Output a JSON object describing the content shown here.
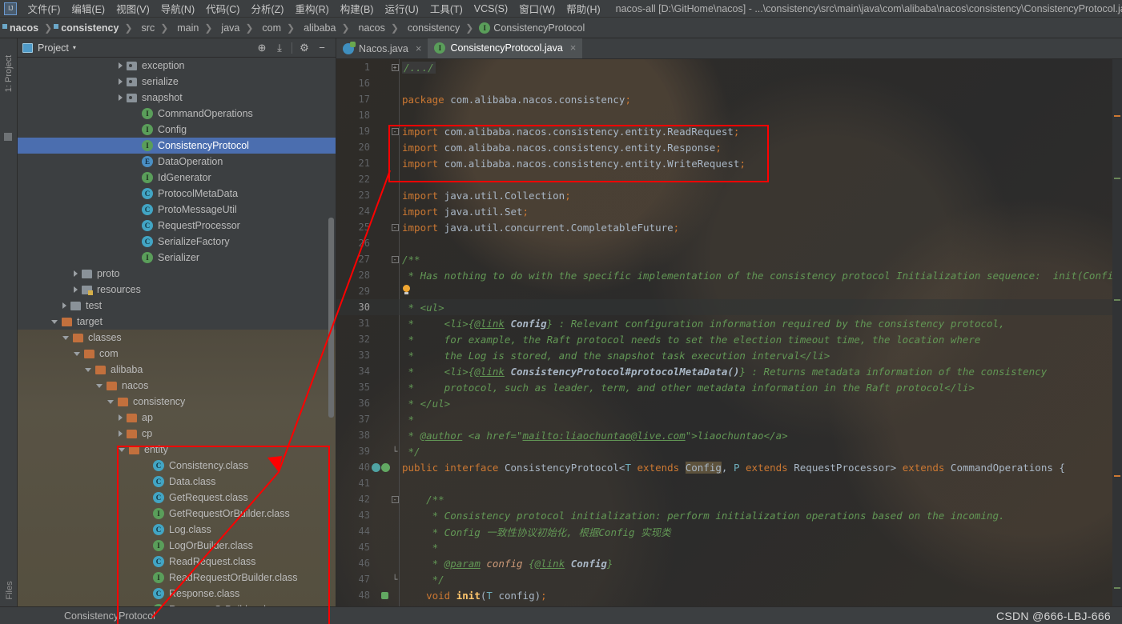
{
  "window": {
    "title": "nacos-all [D:\\GitHome\\nacos] - ...\\consistency\\src\\main\\java\\com\\alibaba\\nacos\\consistency\\ConsistencyProtocol.java [",
    "logo": "app-logo"
  },
  "menu": {
    "items": [
      {
        "label": "文件(F)"
      },
      {
        "label": "编辑(E)"
      },
      {
        "label": "视图(V)"
      },
      {
        "label": "导航(N)"
      },
      {
        "label": "代码(C)"
      },
      {
        "label": "分析(Z)"
      },
      {
        "label": "重构(R)"
      },
      {
        "label": "构建(B)"
      },
      {
        "label": "运行(U)"
      },
      {
        "label": "工具(T)"
      },
      {
        "label": "VCS(S)"
      },
      {
        "label": "窗口(W)"
      },
      {
        "label": "帮助(H)"
      }
    ]
  },
  "breadcrumb": {
    "items": [
      {
        "label": "nacos",
        "icon": "module-icon",
        "bold": true
      },
      {
        "label": "consistency",
        "icon": "module-icon",
        "bold": true
      },
      {
        "label": "src",
        "icon": "folder-icon",
        "bold": false
      },
      {
        "label": "main",
        "icon": "folder-icon",
        "bold": false
      },
      {
        "label": "java",
        "icon": "source-folder-icon",
        "bold": false
      },
      {
        "label": "com",
        "icon": "package-icon",
        "bold": false
      },
      {
        "label": "alibaba",
        "icon": "package-icon",
        "bold": false
      },
      {
        "label": "nacos",
        "icon": "package-icon",
        "bold": false
      },
      {
        "label": "consistency",
        "icon": "package-icon",
        "bold": false
      },
      {
        "label": "ConsistencyProtocol",
        "icon": "interface-icon",
        "bold": false
      }
    ],
    "separator": "❯"
  },
  "left_rail": {
    "top_label": "1: Project",
    "bottom_label": "Files"
  },
  "project_panel": {
    "title": "Project",
    "caret": "▾",
    "buttons": [
      {
        "name": "locate-target-icon",
        "glyph": "⊕"
      },
      {
        "name": "collapse-all-icon",
        "glyph": "⤓"
      },
      {
        "name": "gear-icon",
        "glyph": "⚙"
      },
      {
        "name": "hide-panel-icon",
        "glyph": "−"
      }
    ],
    "tree": [
      {
        "label": "exception",
        "indent": 9,
        "arrow": "right",
        "icon": "package-icon",
        "selected": false,
        "boxed": false
      },
      {
        "label": "serialize",
        "indent": 9,
        "arrow": "right",
        "icon": "package-icon",
        "selected": false,
        "boxed": false
      },
      {
        "label": "snapshot",
        "indent": 9,
        "arrow": "right",
        "icon": "package-icon",
        "selected": false,
        "boxed": false
      },
      {
        "label": "CommandOperations",
        "indent": 10,
        "arrow": "none",
        "icon": "interface-icon",
        "selected": false,
        "boxed": false
      },
      {
        "label": "Config",
        "indent": 10,
        "arrow": "none",
        "icon": "interface-icon",
        "selected": false,
        "boxed": false
      },
      {
        "label": "ConsistencyProtocol",
        "indent": 10,
        "arrow": "none",
        "icon": "interface-icon",
        "selected": true,
        "boxed": false
      },
      {
        "label": "DataOperation",
        "indent": 10,
        "arrow": "none",
        "icon": "enum-icon",
        "selected": false,
        "boxed": false
      },
      {
        "label": "IdGenerator",
        "indent": 10,
        "arrow": "none",
        "icon": "interface-icon",
        "selected": false,
        "boxed": false
      },
      {
        "label": "ProtocolMetaData",
        "indent": 10,
        "arrow": "none",
        "icon": "class-icon",
        "selected": false,
        "boxed": false
      },
      {
        "label": "ProtoMessageUtil",
        "indent": 10,
        "arrow": "none",
        "icon": "class-icon",
        "selected": false,
        "boxed": false
      },
      {
        "label": "RequestProcessor",
        "indent": 10,
        "arrow": "none",
        "icon": "class-icon",
        "selected": false,
        "boxed": false
      },
      {
        "label": "SerializeFactory",
        "indent": 10,
        "arrow": "none",
        "icon": "class-icon",
        "selected": false,
        "boxed": false
      },
      {
        "label": "Serializer",
        "indent": 10,
        "arrow": "none",
        "icon": "interface-icon",
        "selected": false,
        "boxed": false
      },
      {
        "label": "proto",
        "indent": 5,
        "arrow": "right",
        "icon": "folder-icon",
        "selected": false,
        "boxed": false
      },
      {
        "label": "resources",
        "indent": 5,
        "arrow": "right",
        "icon": "resources-icon",
        "selected": false,
        "boxed": false
      },
      {
        "label": "test",
        "indent": 4,
        "arrow": "right",
        "icon": "folder-icon",
        "selected": false,
        "boxed": false
      },
      {
        "label": "target",
        "indent": 3,
        "arrow": "down",
        "icon": "orange-folder-icon",
        "selected": false,
        "boxed": false
      },
      {
        "label": "classes",
        "indent": 4,
        "arrow": "down",
        "icon": "orange-folder-icon",
        "selected": false,
        "boxed": false
      },
      {
        "label": "com",
        "indent": 5,
        "arrow": "down",
        "icon": "orange-folder-icon",
        "selected": false,
        "boxed": false
      },
      {
        "label": "alibaba",
        "indent": 6,
        "arrow": "down",
        "icon": "orange-folder-icon",
        "selected": false,
        "boxed": false
      },
      {
        "label": "nacos",
        "indent": 7,
        "arrow": "down",
        "icon": "orange-folder-icon",
        "selected": false,
        "boxed": false
      },
      {
        "label": "consistency",
        "indent": 8,
        "arrow": "down",
        "icon": "orange-folder-icon",
        "selected": false,
        "boxed": false
      },
      {
        "label": "ap",
        "indent": 9,
        "arrow": "right",
        "icon": "orange-folder-icon",
        "selected": false,
        "boxed": false
      },
      {
        "label": "cp",
        "indent": 9,
        "arrow": "right",
        "icon": "orange-folder-icon",
        "selected": false,
        "boxed": false
      },
      {
        "label": "entity",
        "indent": 9,
        "arrow": "down",
        "icon": "orange-folder-icon",
        "selected": false,
        "boxed": true
      },
      {
        "label": "Consistency.class",
        "indent": 11,
        "arrow": "none",
        "icon": "class-icon",
        "selected": false,
        "boxed": true
      },
      {
        "label": "Data.class",
        "indent": 11,
        "arrow": "none",
        "icon": "class-icon",
        "selected": false,
        "boxed": true
      },
      {
        "label": "GetRequest.class",
        "indent": 11,
        "arrow": "none",
        "icon": "class-icon",
        "selected": false,
        "boxed": true
      },
      {
        "label": "GetRequestOrBuilder.class",
        "indent": 11,
        "arrow": "none",
        "icon": "interface-icon",
        "selected": false,
        "boxed": true
      },
      {
        "label": "Log.class",
        "indent": 11,
        "arrow": "none",
        "icon": "class-icon",
        "selected": false,
        "boxed": true
      },
      {
        "label": "LogOrBuilder.class",
        "indent": 11,
        "arrow": "none",
        "icon": "interface-icon",
        "selected": false,
        "boxed": true
      },
      {
        "label": "ReadRequest.class",
        "indent": 11,
        "arrow": "none",
        "icon": "class-icon",
        "selected": false,
        "boxed": true
      },
      {
        "label": "ReadRequestOrBuilder.class",
        "indent": 11,
        "arrow": "none",
        "icon": "interface-icon",
        "selected": false,
        "boxed": true
      },
      {
        "label": "Response.class",
        "indent": 11,
        "arrow": "none",
        "icon": "class-icon",
        "selected": false,
        "boxed": true
      },
      {
        "label": "ResponseOrBuilder.class",
        "indent": 11,
        "arrow": "none",
        "icon": "interface-icon",
        "selected": false,
        "boxed": true
      }
    ]
  },
  "editor": {
    "tabs": [
      {
        "label": "Nacos.java",
        "icon": "nacos-file-icon",
        "active": false,
        "close": "×"
      },
      {
        "label": "ConsistencyProtocol.java",
        "icon": "interface-icon",
        "active": true,
        "close": "×"
      }
    ],
    "lines": [
      {
        "n": "1",
        "fold": "+",
        "text": "/.../",
        "type": "folded",
        "current": false
      },
      {
        "n": "16",
        "fold": "",
        "text": "",
        "type": "plain",
        "current": false
      },
      {
        "n": "17",
        "fold": "",
        "text": "package com.alibaba.nacos.consistency;",
        "type": "package",
        "current": false
      },
      {
        "n": "18",
        "fold": "",
        "text": "",
        "type": "plain",
        "current": false
      },
      {
        "n": "19",
        "fold": "-",
        "text": "import com.alibaba.nacos.consistency.entity.ReadRequest;",
        "type": "import",
        "current": false
      },
      {
        "n": "20",
        "fold": "",
        "text": "import com.alibaba.nacos.consistency.entity.Response;",
        "type": "import",
        "current": false
      },
      {
        "n": "21",
        "fold": "",
        "text": "import com.alibaba.nacos.consistency.entity.WriteRequest;",
        "type": "import",
        "current": false
      },
      {
        "n": "22",
        "fold": "",
        "text": "",
        "type": "plain",
        "current": false
      },
      {
        "n": "23",
        "fold": "",
        "text": "import java.util.Collection;",
        "type": "import",
        "current": false
      },
      {
        "n": "24",
        "fold": "",
        "text": "import java.util.Set;",
        "type": "import",
        "current": false
      },
      {
        "n": "25",
        "fold": "-",
        "text": "import java.util.concurrent.CompletableFuture;",
        "type": "import",
        "current": false
      },
      {
        "n": "26",
        "fold": "",
        "text": "",
        "type": "plain",
        "current": false
      },
      {
        "n": "27",
        "fold": "-",
        "text": "/**",
        "type": "comment",
        "current": false
      },
      {
        "n": "28",
        "fold": "",
        "text": " * Has nothing to do with the specific implementation of the consistency protocol Initialization sequence:  init(Config).",
        "type": "comment",
        "current": false
      },
      {
        "n": "29",
        "fold": "",
        "text": "",
        "type": "bulb",
        "current": false
      },
      {
        "n": "30",
        "fold": "",
        "text": " * <ul>",
        "type": "comment",
        "current": true
      },
      {
        "n": "31",
        "fold": "",
        "text": " *     <li>{@link Config} : Relevant configuration information required by the consistency protocol,",
        "type": "comment-link",
        "current": false
      },
      {
        "n": "32",
        "fold": "",
        "text": " *     for example, the Raft protocol needs to set the election timeout time, the location where",
        "type": "comment",
        "current": false
      },
      {
        "n": "33",
        "fold": "",
        "text": " *     the Log is stored, and the snapshot task execution interval</li>",
        "type": "comment",
        "current": false
      },
      {
        "n": "34",
        "fold": "",
        "text": " *     <li>{@link ConsistencyProtocol#protocolMetaData()} : Returns metadata information of the consistency",
        "type": "comment-link2",
        "current": false
      },
      {
        "n": "35",
        "fold": "",
        "text": " *     protocol, such as leader, term, and other metadata information in the Raft protocol</li>",
        "type": "comment",
        "current": false
      },
      {
        "n": "36",
        "fold": "",
        "text": " * </ul>",
        "type": "comment",
        "current": false
      },
      {
        "n": "37",
        "fold": "",
        "text": " *",
        "type": "comment",
        "current": false
      },
      {
        "n": "38",
        "fold": "",
        "text": " * @author <a href=\"mailto:liaochuntao@live.com\">liaochuntao</a>",
        "type": "comment-author",
        "current": false
      },
      {
        "n": "39",
        "fold": "^",
        "text": " */",
        "type": "comment",
        "current": false
      },
      {
        "n": "40",
        "fold": "",
        "text": "public interface ConsistencyProtocol<T extends Config, P extends RequestProcessor> extends CommandOperations {",
        "type": "decl",
        "current": false
      },
      {
        "n": "41",
        "fold": "",
        "text": "",
        "type": "plain",
        "current": false
      },
      {
        "n": "42",
        "fold": "-",
        "text": "    /**",
        "type": "comment",
        "current": false
      },
      {
        "n": "43",
        "fold": "",
        "text": "     * Consistency protocol initialization: perform initialization operations based on the incoming.",
        "type": "comment",
        "current": false
      },
      {
        "n": "44",
        "fold": "",
        "text": "     * Config 一致性协议初始化, 根据Config 实现类",
        "type": "comment",
        "current": false
      },
      {
        "n": "45",
        "fold": "",
        "text": "     *",
        "type": "comment",
        "current": false
      },
      {
        "n": "46",
        "fold": "",
        "text": "     * @param config {@link Config}",
        "type": "comment-param",
        "current": false
      },
      {
        "n": "47",
        "fold": "^",
        "text": "     */",
        "type": "comment",
        "current": false
      },
      {
        "n": "48",
        "fold": "",
        "text": "    void init(T config);",
        "type": "method",
        "current": false
      }
    ],
    "declaration": {
      "kw_public": "public",
      "kw_interface": "interface",
      "name": "ConsistencyProtocol",
      "generic_open": "<T ",
      "kw_extends1": "extends",
      "bound1": "Config",
      "mid": ", P ",
      "kw_extends2": "extends",
      "bound2": "RequestProcessor",
      "generic_close": "> ",
      "kw_extends3": "extends",
      "super": "CommandOperations",
      "brace": " {"
    }
  },
  "annotations": {
    "import_box_label": "imports-highlight-box",
    "tree_box_label": "entity-classes-highlight-box",
    "arrow_label": "red-connector-arrow",
    "color": "#ff0000"
  },
  "status_bar": {
    "file": "ConsistencyProtocol",
    "watermark": "CSDN @666-LBJ-666"
  }
}
